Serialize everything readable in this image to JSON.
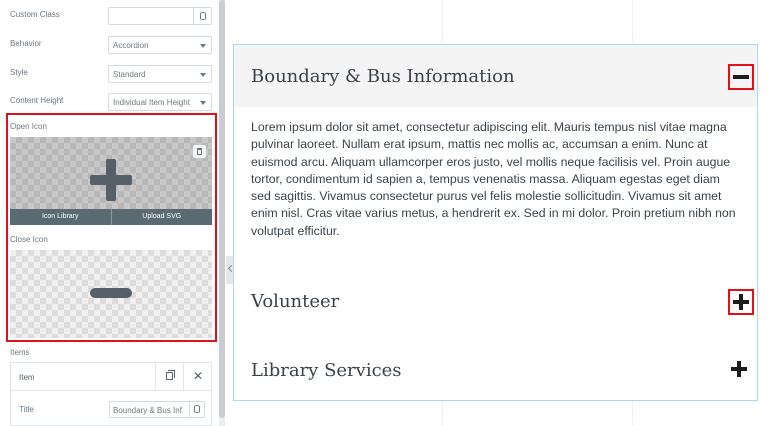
{
  "settings": {
    "custom_class": {
      "label": "Custom Class",
      "value": ""
    },
    "behavior": {
      "label": "Behavior",
      "value": "Accordion"
    },
    "style": {
      "label": "Style",
      "value": "Standard"
    },
    "content_height": {
      "label": "Content Height",
      "value": "Individual Item Height"
    },
    "open_icon": {
      "label": "Open Icon",
      "library_label": "Icon Library",
      "upload_label": "Upload SVG",
      "icon": "plus-icon"
    },
    "close_icon": {
      "label": "Close Icon",
      "icon": "minus-icon"
    },
    "items": {
      "label": "Items",
      "item_name": "Item",
      "title_label": "Title",
      "title_value": "Boundary & Bus Inf"
    }
  },
  "accordion": {
    "items": [
      {
        "title": "Boundary & Bus Information",
        "expanded": true,
        "content": "Lorem ipsum dolor sit amet, consectetur adipiscing elit. Mauris tempus nisl vitae magna pulvinar laoreet. Nullam erat ipsum, mattis nec mollis ac, accumsan a enim. Nunc at euismod arcu. Aliquam ullamcorper eros justo, vel mollis neque facilisis vel. Proin augue tortor, condimentum id sapien a, tempus venenatis massa. Aliquam egestas eget diam sed sagittis. Vivamus consectetur purus vel felis molestie sollicitudin. Vivamus sit amet enim nisl. Cras vitae varius metus, a hendrerit ex. Sed in mi dolor. Proin pretium nibh non volutpat efficitur."
      },
      {
        "title": "Volunteer",
        "expanded": false
      },
      {
        "title": "Library Services",
        "expanded": false
      }
    ]
  },
  "colors": {
    "highlight": "#e3101c",
    "accordion_border": "#a9d9ec",
    "icon_bar": "#5a6a73"
  }
}
